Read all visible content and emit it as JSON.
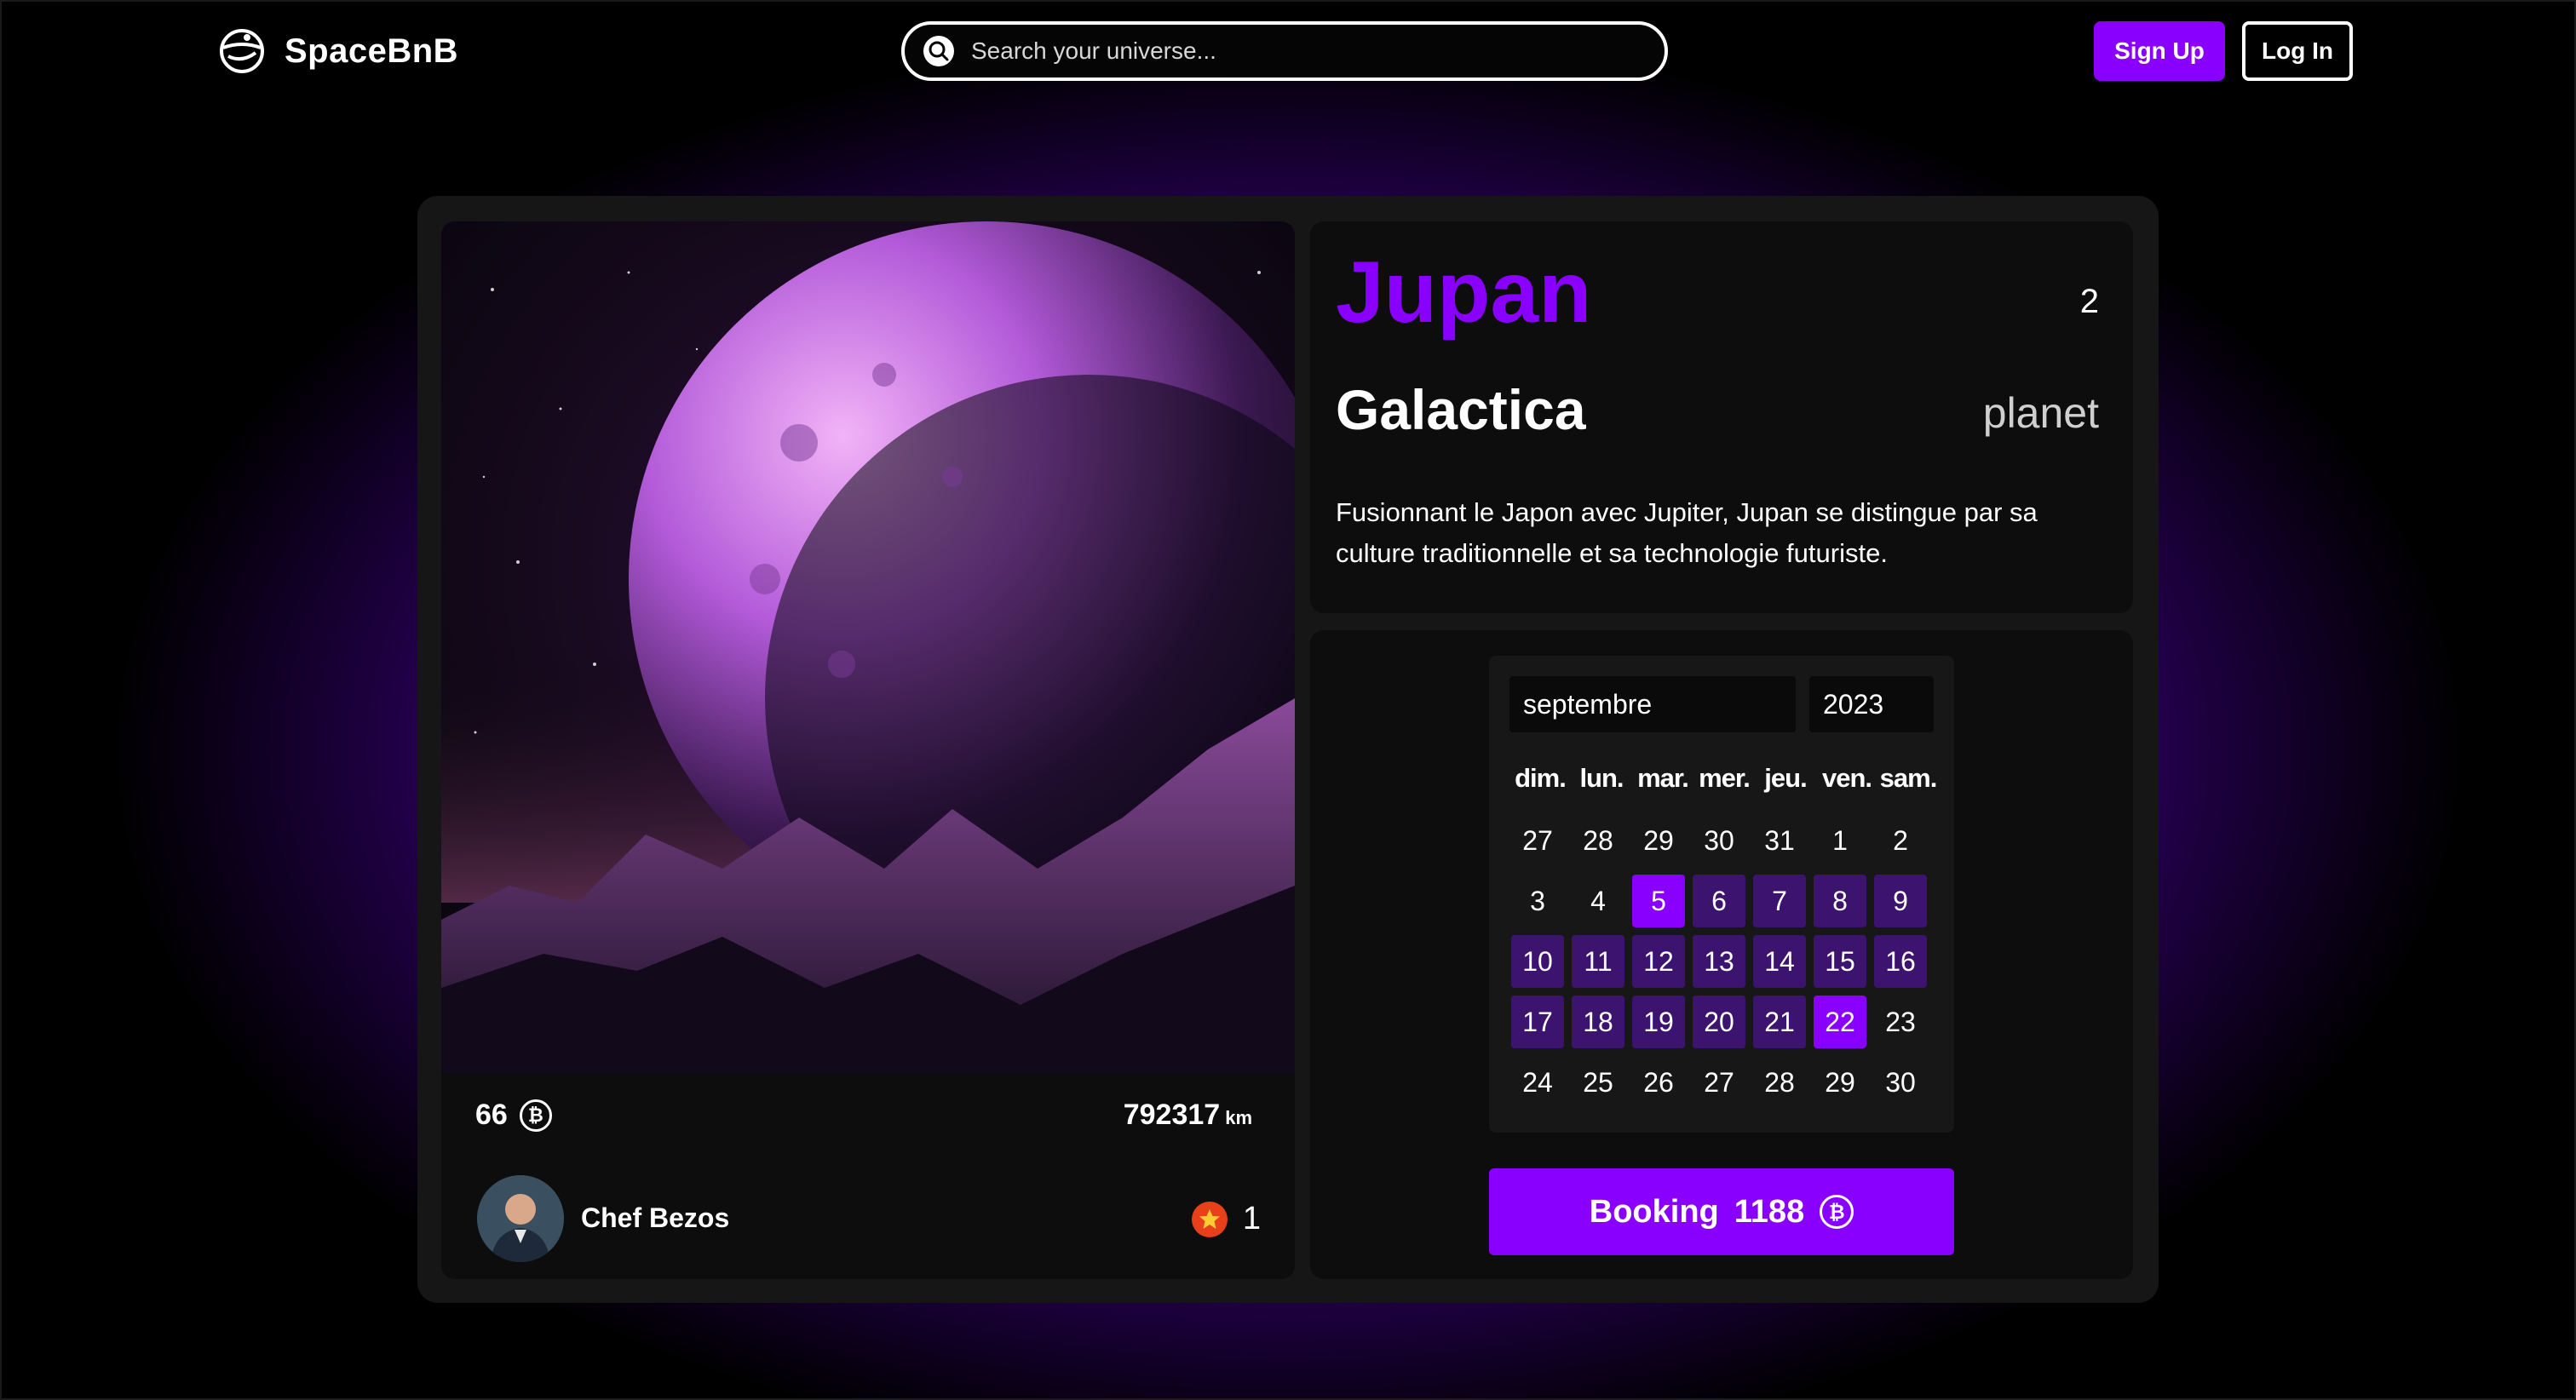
{
  "header": {
    "brand": "SpaceBnB",
    "search_placeholder": "Search your universe...",
    "signup_label": "Sign Up",
    "login_label": "Log In"
  },
  "listing": {
    "name": "Jupan",
    "count": "2",
    "galaxy": "Galactica",
    "type": "planet",
    "description": "Fusionnant le Japon avec Jupiter, Jupan se distingue par sa culture traditionnelle et sa technologie futuriste.",
    "price": "66",
    "distance": "792317",
    "distance_unit": "km",
    "owner": "Chef Bezos",
    "rating": "1",
    "image_icon": "planet-image",
    "coin_icon": "bitcoin-icon",
    "coin_glyph": "₿"
  },
  "calendar": {
    "month": "septembre",
    "year": "2023",
    "weekdays": [
      "dim.",
      "lun.",
      "mar.",
      "mer.",
      "jeu.",
      "ven.",
      "sam."
    ],
    "weeks": [
      [
        "27",
        "28",
        "29",
        "30",
        "31",
        "1",
        "2"
      ],
      [
        "3",
        "4",
        "5",
        "6",
        "7",
        "8",
        "9"
      ],
      [
        "10",
        "11",
        "12",
        "13",
        "14",
        "15",
        "16"
      ],
      [
        "17",
        "18",
        "19",
        "20",
        "21",
        "22",
        "23"
      ],
      [
        "24",
        "25",
        "26",
        "27",
        "28",
        "29",
        "30"
      ]
    ],
    "range_start": "5",
    "range_end": "22"
  },
  "booking": {
    "label": "Booking",
    "total": "1188"
  },
  "colors": {
    "accent": "#8a00ff",
    "range": "#3c1470",
    "rating_badge": "#e8401a"
  }
}
